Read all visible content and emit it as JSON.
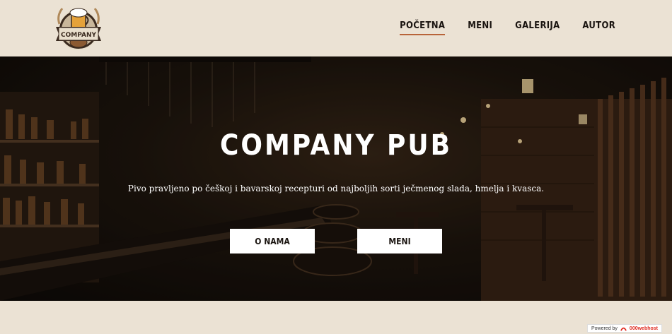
{
  "header": {
    "logo_text": "COMPANY",
    "nav": [
      {
        "label": "POČETNA",
        "active": true
      },
      {
        "label": "MENI",
        "active": false
      },
      {
        "label": "GALERIJA",
        "active": false
      },
      {
        "label": "AUTOR",
        "active": false
      }
    ]
  },
  "hero": {
    "title": "COMPANY PUB",
    "subtitle": "Pivo pravljeno po češkoj i bavarskoj recepturi od najboljih sorti ječmenog slada, hmelja i kvasca.",
    "button_about": "O NAMA",
    "button_menu": "MENI"
  },
  "footer": {
    "powered_by": "Powered by",
    "host": "000webhost"
  },
  "colors": {
    "background": "#ebe2d4",
    "nav_active_underline": "#b8643a",
    "hero_dark": "#1f160e",
    "button_bg": "#ffffff"
  },
  "icons": [
    "company-logo",
    "webhost-icon"
  ]
}
